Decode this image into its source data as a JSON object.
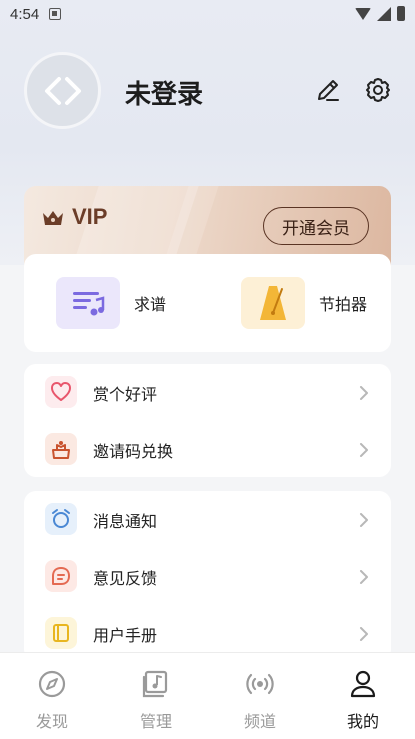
{
  "status_bar": {
    "time": "4:54"
  },
  "profile": {
    "username": "未登录"
  },
  "vip": {
    "label": "VIP",
    "open_button": "开通会员"
  },
  "quick_actions": [
    {
      "label": "求谱",
      "icon": "sheet-music-icon"
    },
    {
      "label": "节拍器",
      "icon": "metronome-icon"
    }
  ],
  "menu_group_1": [
    {
      "label": "赏个好评",
      "icon": "heart-icon"
    },
    {
      "label": "邀请码兑换",
      "icon": "gift-icon"
    }
  ],
  "menu_group_2": [
    {
      "label": "消息通知",
      "icon": "notification-icon"
    },
    {
      "label": "意见反馈",
      "icon": "feedback-icon"
    },
    {
      "label": "用户手册",
      "icon": "manual-icon"
    }
  ],
  "tabs": [
    {
      "label": "发现",
      "icon": "compass-icon"
    },
    {
      "label": "管理",
      "icon": "music-library-icon"
    },
    {
      "label": "频道",
      "icon": "broadcast-icon"
    },
    {
      "label": "我的",
      "icon": "person-icon",
      "active": true
    }
  ],
  "colors": {
    "accent_brown": "#6b3d28",
    "quick_purple_bg": "#ebe7fb",
    "quick_yellow_bg": "#fdf0d6",
    "tab_active": "#1a1a1a",
    "tab_inactive": "#9a9a9a"
  }
}
